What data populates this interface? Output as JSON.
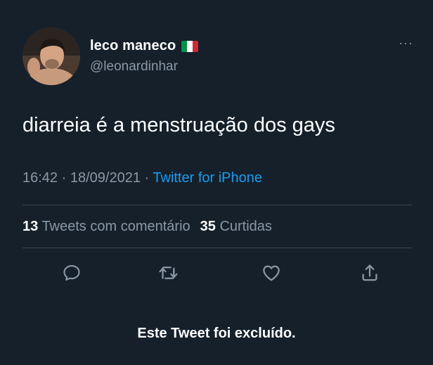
{
  "author": {
    "display_name": "leco maneco",
    "handle": "@leonardinhar",
    "flag_colors": [
      "#009246",
      "#ffffff",
      "#ce2b37"
    ]
  },
  "menu_label": "···",
  "tweet": {
    "text": "diarreia é a menstruação dos gays"
  },
  "meta": {
    "time": "16:42",
    "separator1": " · ",
    "date": "18/09/2021",
    "separator2": " · ",
    "source": "Twitter for iPhone"
  },
  "stats": {
    "quote_count": "13",
    "quote_label": " Tweets com comentário",
    "retweet_count": "35",
    "retweet_label": " Curtidas"
  },
  "actions": [
    "reply-icon",
    "retweet-icon",
    "like-icon",
    "share-icon"
  ],
  "notice": "Este Tweet foi excluído.",
  "colors": {
    "background": "#15202b",
    "secondary_text": "#8b98a5",
    "accent": "#1d9bf0",
    "divider": "#38444d"
  }
}
